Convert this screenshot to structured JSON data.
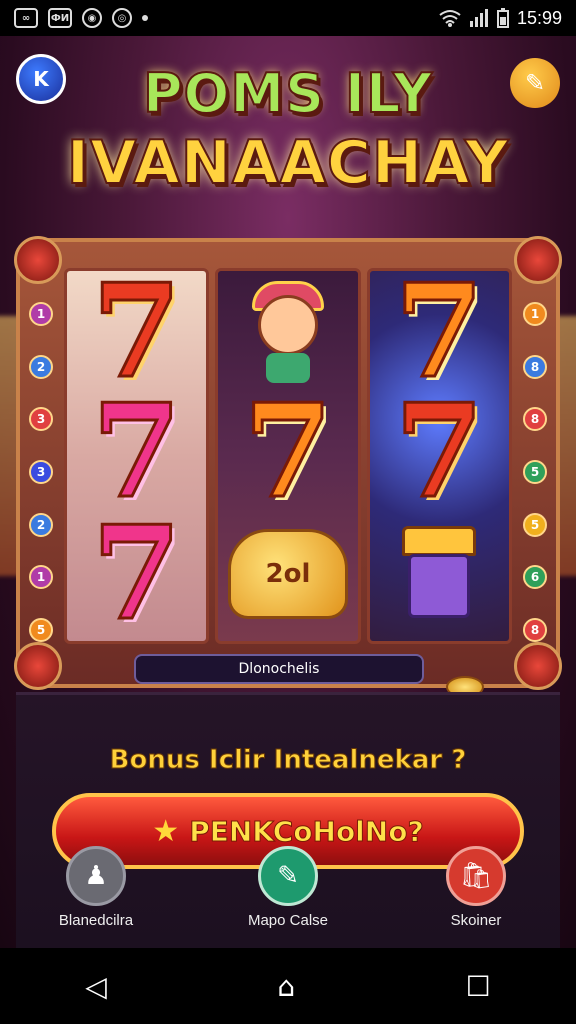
{
  "status_bar": {
    "time": "15:99",
    "left_icons": [
      "notification-icon",
      "image-icon",
      "app-icon",
      "app-icon-2"
    ],
    "right_icons": [
      "wifi-icon",
      "signal-icon",
      "battery-icon"
    ],
    "icon_glyphs": {
      "img": "ФИ",
      "app": "◉",
      "app2": "◎"
    }
  },
  "game": {
    "title_line1": "POMS ILY",
    "title_line2": "IVANAACHAY",
    "reel_plate": "Dlonochelis",
    "bonus_text": "Bonus Iclir Intealnekar ?",
    "spin_label": "PENKCoHolNo?",
    "spin_star": "★",
    "left_numbers": [
      "1",
      "2",
      "3",
      "3",
      "2",
      "1",
      "5"
    ],
    "right_numbers": [
      "1",
      "8",
      "8",
      "5",
      "5",
      "6",
      "8"
    ],
    "reel_mid_bag_text": "2ol"
  },
  "bottom_nav": [
    {
      "label": "Blanedcilra",
      "icon": "person-icon",
      "color": "#6a6a72",
      "glyph": "♟"
    },
    {
      "label": "Mapo Calse",
      "icon": "map-icon",
      "color": "#1e9a6e",
      "glyph": "✎"
    },
    {
      "label": "Skoiner",
      "icon": "shop-icon",
      "color": "#d63a2e",
      "glyph": "🛍"
    }
  ],
  "system_nav": {
    "back": "◁",
    "home": "⌂",
    "recents": "☐"
  }
}
